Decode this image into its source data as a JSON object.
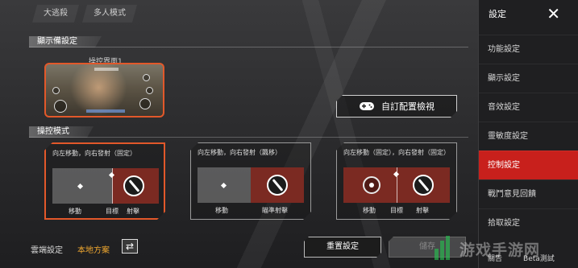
{
  "top_tabs": [
    "大逃殺",
    "多人模式"
  ],
  "sections": {
    "display": "顯示備設定",
    "control_mode": "操控模式"
  },
  "preview": {
    "label": "操控界面1"
  },
  "custom_layout_button": "自訂配置檢視",
  "modes": [
    {
      "title": "向左移動，向右發射（固定）",
      "labels": [
        "移動",
        "目標",
        "射擊"
      ],
      "selected": true
    },
    {
      "title": "向左移動，向右發射（飄移）",
      "labels": [
        "移動",
        "瞄準射擊"
      ],
      "selected": false
    },
    {
      "title": "向左移動（固定），向右發射（固定）",
      "labels": [
        "移動",
        "目標",
        "射擊"
      ],
      "selected": false
    }
  ],
  "bottom": {
    "cloud_label": "雲端設定",
    "local_label": "本地方案",
    "reset_button": "重置設定",
    "save_button": "儲存"
  },
  "sidebar": {
    "title": "設定",
    "items": [
      {
        "label": "功能設定",
        "active": false
      },
      {
        "label": "顯示設定",
        "active": false
      },
      {
        "label": "音效設定",
        "active": false
      },
      {
        "label": "靈敏度設定",
        "active": false
      },
      {
        "label": "控制設定",
        "active": true
      },
      {
        "label": "戰鬥意見回饋",
        "active": false
      },
      {
        "label": "拾取設定",
        "active": false
      }
    ],
    "footer_left": "關告",
    "footer_right": "Beta測試"
  },
  "watermark": "游戏手游网",
  "colors": {
    "accent": "#e2582a",
    "active_tab": "#c8201c",
    "pad_red": "#7b2a22"
  }
}
